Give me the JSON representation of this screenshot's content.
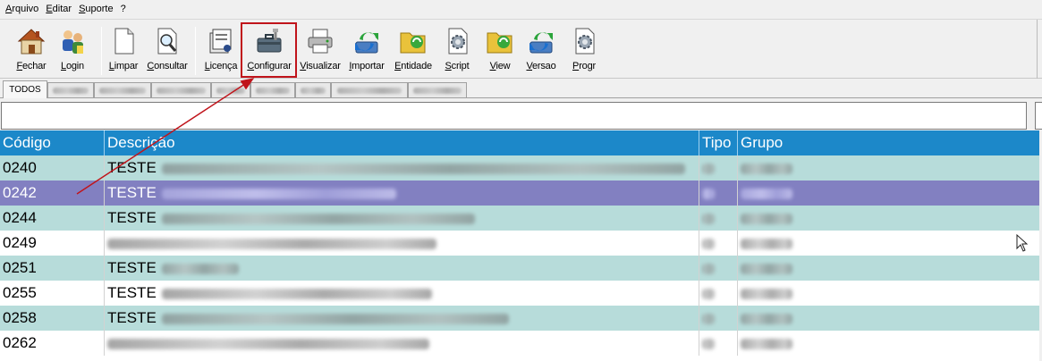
{
  "menubar": {
    "items": [
      "Arquivo",
      "Editar",
      "Suporte",
      "?"
    ]
  },
  "toolbar": {
    "buttons": [
      {
        "label": "Fechar",
        "icon": "house-icon"
      },
      {
        "label": "Login",
        "icon": "users-icon"
      },
      {
        "label": "Limpar",
        "icon": "blank-page-icon"
      },
      {
        "label": "Consultar",
        "icon": "magnifier-page-icon"
      },
      {
        "label": "Licença",
        "icon": "license-icon"
      },
      {
        "label": "Configurar",
        "icon": "toolbox-icon"
      },
      {
        "label": "Visualizar",
        "icon": "printer-icon"
      },
      {
        "label": "Importar",
        "icon": "import-arrows-icon"
      },
      {
        "label": "Entidade",
        "icon": "folder-refresh-icon"
      },
      {
        "label": "Script",
        "icon": "gear-page-icon"
      },
      {
        "label": "View",
        "icon": "folder-view-icon"
      },
      {
        "label": "Versao",
        "icon": "version-arrows-icon"
      },
      {
        "label": "Progr",
        "icon": "gear-document-icon"
      }
    ]
  },
  "tabs": {
    "active": "TODOS"
  },
  "filter": {
    "value": ""
  },
  "grid": {
    "columns": [
      "Código",
      "Descrição",
      "Tipo",
      "Grupo"
    ],
    "rows": [
      {
        "code": "0240",
        "prefix": "TESTE"
      },
      {
        "code": "0242",
        "prefix": "TESTE"
      },
      {
        "code": "0244",
        "prefix": "TESTE"
      },
      {
        "code": "0249",
        "prefix": ""
      },
      {
        "code": "0251",
        "prefix": "TESTE"
      },
      {
        "code": "0255",
        "prefix": "TESTE"
      },
      {
        "code": "0258",
        "prefix": "TESTE"
      },
      {
        "code": "0262",
        "prefix": ""
      }
    ]
  },
  "colors": {
    "header": "#1c88c9",
    "row_teal": "#b7dcda",
    "row_selected": "#8280c1",
    "annotation": "#c0141b"
  }
}
